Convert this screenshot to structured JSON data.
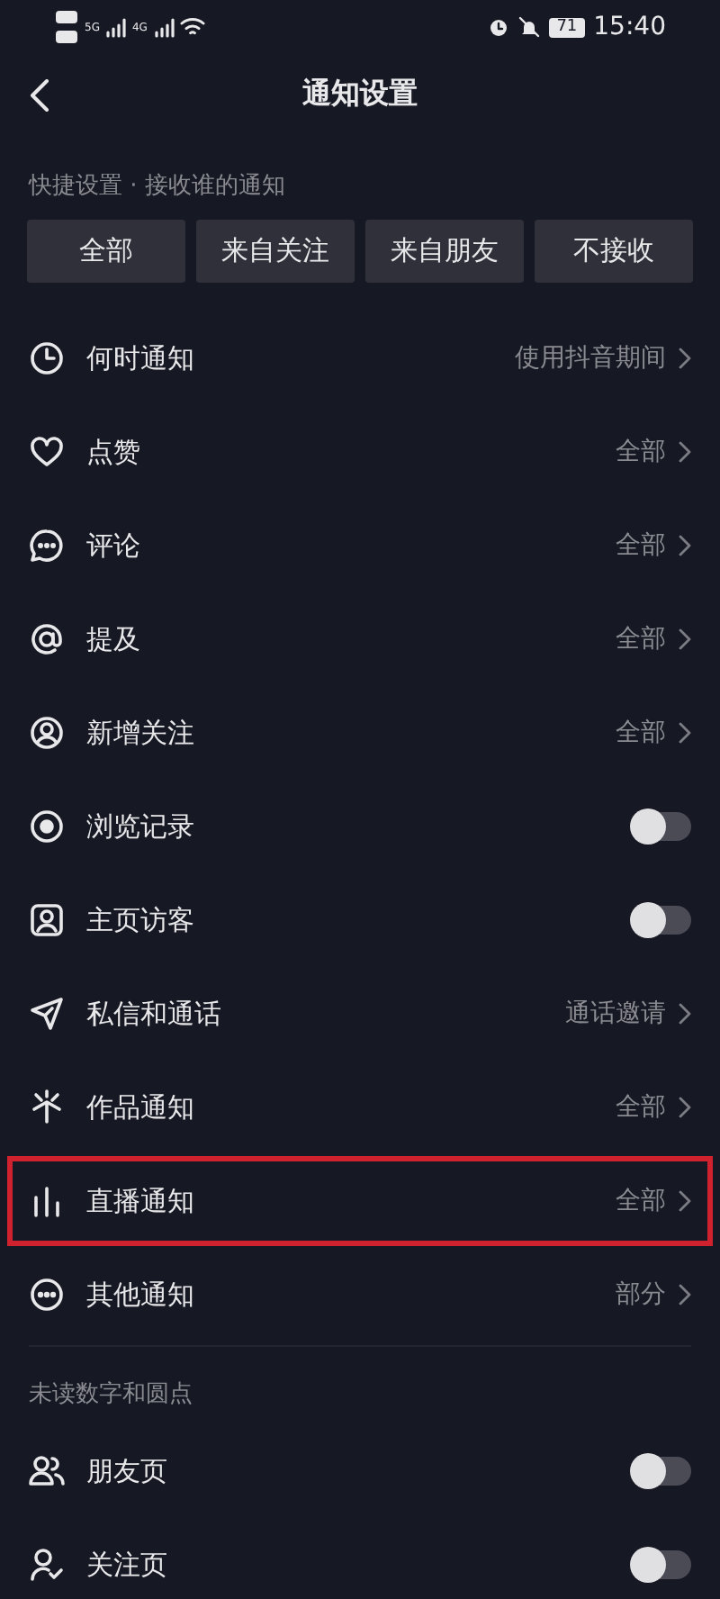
{
  "status_bar": {
    "network_1": "5G",
    "network_2": "4G",
    "battery": "71",
    "time": "15:40"
  },
  "header": {
    "title": "通知设置"
  },
  "quick_settings": {
    "label": "快捷设置 · 接收谁的通知",
    "options": [
      {
        "label": "全部",
        "selected": false
      },
      {
        "label": "来自关注",
        "selected": false
      },
      {
        "label": "来自朋友",
        "selected": false
      },
      {
        "label": "不接收",
        "selected": false
      }
    ]
  },
  "settings": [
    {
      "kind": "link",
      "label": "何时通知",
      "value": "使用抖音期间",
      "highlighted": false
    },
    {
      "kind": "link",
      "label": "点赞",
      "value": "全部",
      "highlighted": false
    },
    {
      "kind": "link",
      "label": "评论",
      "value": "全部",
      "highlighted": false
    },
    {
      "kind": "link",
      "label": "提及",
      "value": "全部",
      "highlighted": false
    },
    {
      "kind": "link",
      "label": "新增关注",
      "value": "全部",
      "highlighted": false
    },
    {
      "kind": "toggle",
      "label": "浏览记录",
      "on": false,
      "highlighted": false
    },
    {
      "kind": "toggle",
      "label": "主页访客",
      "on": false,
      "highlighted": false
    },
    {
      "kind": "link",
      "label": "私信和通话",
      "value": "通话邀请",
      "highlighted": false
    },
    {
      "kind": "link",
      "label": "作品通知",
      "value": "全部",
      "highlighted": false
    },
    {
      "kind": "link",
      "label": "直播通知",
      "value": "全部",
      "highlighted": true
    },
    {
      "kind": "link",
      "label": "其他通知",
      "value": "部分",
      "highlighted": false
    }
  ],
  "unread_section": {
    "label": "未读数字和圆点",
    "items": [
      {
        "kind": "toggle",
        "label": "朋友页",
        "on": false
      },
      {
        "kind": "toggle",
        "label": "关注页",
        "on": false
      }
    ]
  }
}
